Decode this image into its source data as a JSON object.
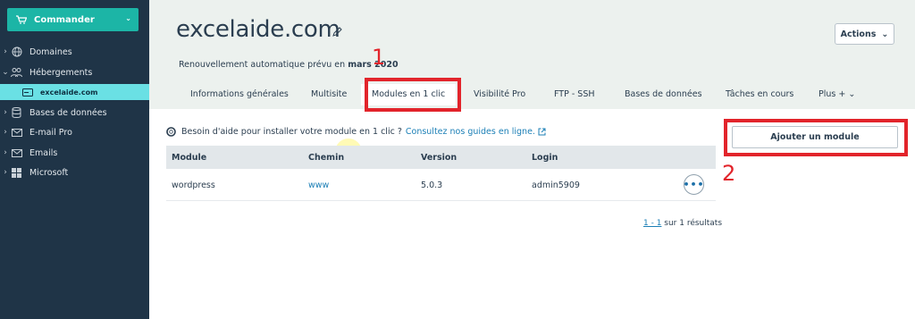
{
  "sidebar": {
    "commander_label": "Commander",
    "items": [
      {
        "label": "Domaines"
      },
      {
        "label": "Hébergements"
      },
      {
        "label": "excelaide.com"
      },
      {
        "label": "Bases de données"
      },
      {
        "label": "E-mail Pro"
      },
      {
        "label": "Emails"
      },
      {
        "label": "Microsoft"
      }
    ]
  },
  "header": {
    "title": "excelaide.com",
    "renewal_prefix": "Renouvellement automatique prévu en ",
    "renewal_date": "mars 2020",
    "actions_label": "Actions"
  },
  "tabs": [
    {
      "label": "Informations générales"
    },
    {
      "label": "Multisite"
    },
    {
      "label": "Modules en 1 clic"
    },
    {
      "label": "Visibilité Pro"
    },
    {
      "label": "FTP - SSH"
    },
    {
      "label": "Bases de données"
    },
    {
      "label": "Tâches en cours"
    },
    {
      "label": "Plus +"
    }
  ],
  "help": {
    "text": "Besoin d'aide pour installer votre module en 1 clic ?",
    "link": "Consultez nos guides en ligne."
  },
  "table": {
    "headers": [
      "Module",
      "Chemin",
      "Version",
      "Login"
    ],
    "rows": [
      {
        "module": "wordpress",
        "chemin": "www",
        "version": "5.0.3",
        "login": "admin5909"
      }
    ]
  },
  "pagination": {
    "range": "1 - 1",
    "suffix": " sur 1 résultats"
  },
  "add_module_label": "Ajouter un module",
  "annotations": {
    "one": "1",
    "two": "2"
  },
  "colors": {
    "sidebar": "#1f3447",
    "accent": "#1cb5a6",
    "active_item": "#6ae0e4",
    "header_bg": "#ecf1ee",
    "annotation_red": "#e2242b",
    "link": "#1b7fb6"
  }
}
